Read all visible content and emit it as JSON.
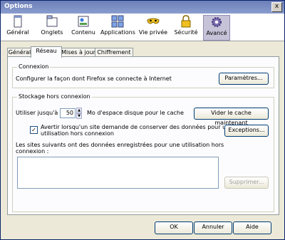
{
  "window": {
    "title": "Options",
    "close_label": "x"
  },
  "toolbar": {
    "items": [
      {
        "label": "Général",
        "icon": "general-window-icon"
      },
      {
        "label": "Onglets",
        "icon": "tabs-icon"
      },
      {
        "label": "Contenu",
        "icon": "content-icon"
      },
      {
        "label": "Applications",
        "icon": "applications-icon"
      },
      {
        "label": "Vie privée",
        "icon": "privacy-mask-icon"
      },
      {
        "label": "Sécurité",
        "icon": "padlock-icon"
      },
      {
        "label": "Avancé",
        "icon": "gear-icon"
      }
    ],
    "active": "Avancé"
  },
  "tabs": [
    {
      "label": "Général"
    },
    {
      "label": "Réseau"
    },
    {
      "label": "Mises à jour"
    },
    {
      "label": "Chiffrement"
    }
  ],
  "connexion": {
    "title": "Connexion",
    "description": "Configurer la façon dont Firefox se connecte à Internet",
    "settings_button": "Paramètres..."
  },
  "offline": {
    "title": "Stockage hors connexion",
    "use_label": "Utiliser jusqu'à",
    "value": "50",
    "unit_label": "Mo d'espace disque pour le cache",
    "clear_button": "Vider le cache maintenant",
    "warn_checked": true,
    "warn_label_line1": "Avertir lorsqu'un site demande de conserver des données pour une",
    "warn_label_line2": "utilisation hors connexion",
    "exceptions_button": "Exceptions...",
    "sites_label_line1": "Les sites suivants ont des données enregistrées pour une utilisation hors",
    "sites_label_line2": "connexion :",
    "remove_button": "Supprimer..."
  },
  "footer": {
    "ok": "OK",
    "cancel": "Annuler",
    "help": "Aide"
  },
  "colors": {
    "accent": "#0a246a",
    "active_tab_bg": "#c6c3d8"
  }
}
